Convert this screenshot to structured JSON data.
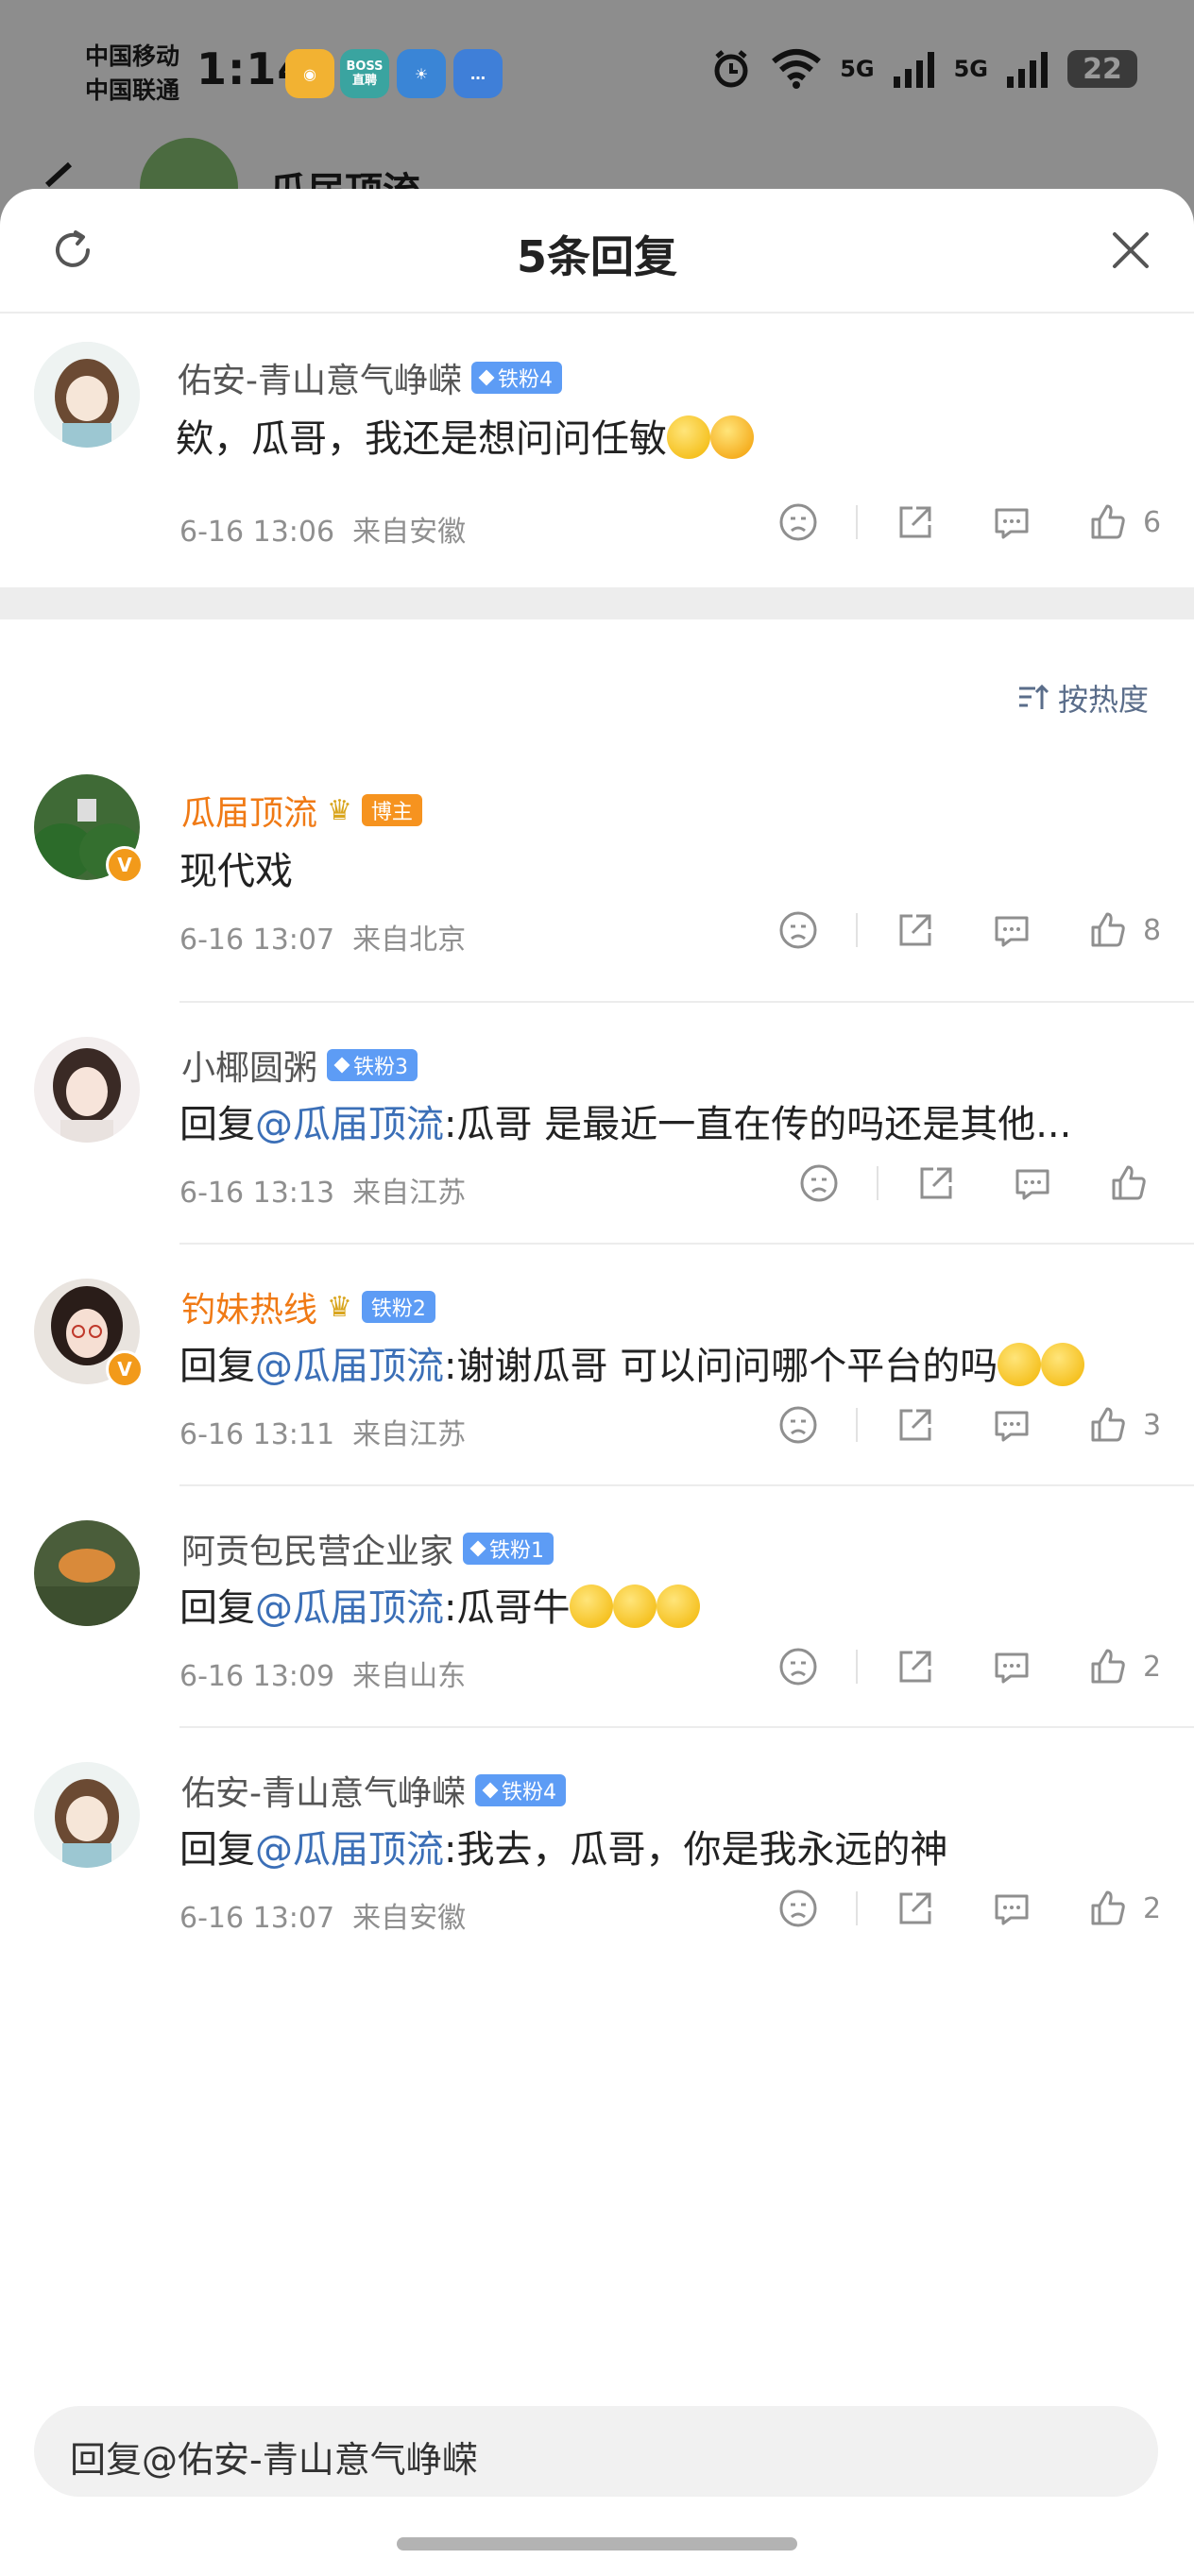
{
  "status_bar": {
    "carrier_1": "中国移动",
    "carrier_2": "中国联通",
    "time": "1:14",
    "app_icons": [
      "weibo-app-icon",
      "boss-zhipin-app-icon",
      "weather-app-icon",
      "messages-app-icon"
    ],
    "boss_label_1": "BOSS",
    "boss_label_2": "直聘",
    "net_1": "5G",
    "net_2": "5G",
    "battery": "22"
  },
  "background_page": {
    "title": "瓜届顶流"
  },
  "sheet": {
    "title": "5条回复",
    "sort_label": "按热度"
  },
  "root_comment": {
    "username": "佑安-青山意气峥嵘",
    "badge": "铁粉4",
    "text": "欸，瓜哥，我还是想问问任敏",
    "time": "6-16 13:06",
    "location": "来自安徽",
    "likes": "6"
  },
  "replies": [
    {
      "username": "瓜届顶流",
      "badge": "博主",
      "text": "现代戏",
      "time": "6-16 13:07",
      "location": "来自北京",
      "likes": "8"
    },
    {
      "username": "小椰圆粥",
      "badge": "铁粉3",
      "prefix": "回复",
      "mention": "@瓜届顶流",
      "text": ":瓜哥 是最近一直在传的吗还是其他...",
      "time": "6-16 13:13",
      "location": "来自江苏",
      "likes": ""
    },
    {
      "username": "钓妹热线",
      "badge": "铁粉2",
      "prefix": "回复",
      "mention": "@瓜届顶流",
      "text": ":谢谢瓜哥 可以问问哪个平台的吗",
      "time": "6-16 13:11",
      "location": "来自江苏",
      "likes": "3"
    },
    {
      "username": "阿贡包民营企业家",
      "badge": "铁粉1",
      "prefix": "回复",
      "mention": "@瓜届顶流",
      "text": ":瓜哥牛",
      "time": "6-16 13:09",
      "location": "来自山东",
      "likes": "2"
    },
    {
      "username": "佑安-青山意气峥嵘",
      "badge": "铁粉4",
      "prefix": "回复",
      "mention": "@瓜届顶流",
      "text": ":我去，瓜哥，你是我永远的神",
      "time": "6-16 13:07",
      "location": "来自安徽",
      "likes": "2"
    }
  ],
  "reply_input": {
    "placeholder": "回复@佑安-青山意气峥嵘"
  },
  "colors": {
    "accent_orange": "#f07a15",
    "mention_blue": "#3b6fb7",
    "fan_badge_blue": "#5d9cf5"
  }
}
